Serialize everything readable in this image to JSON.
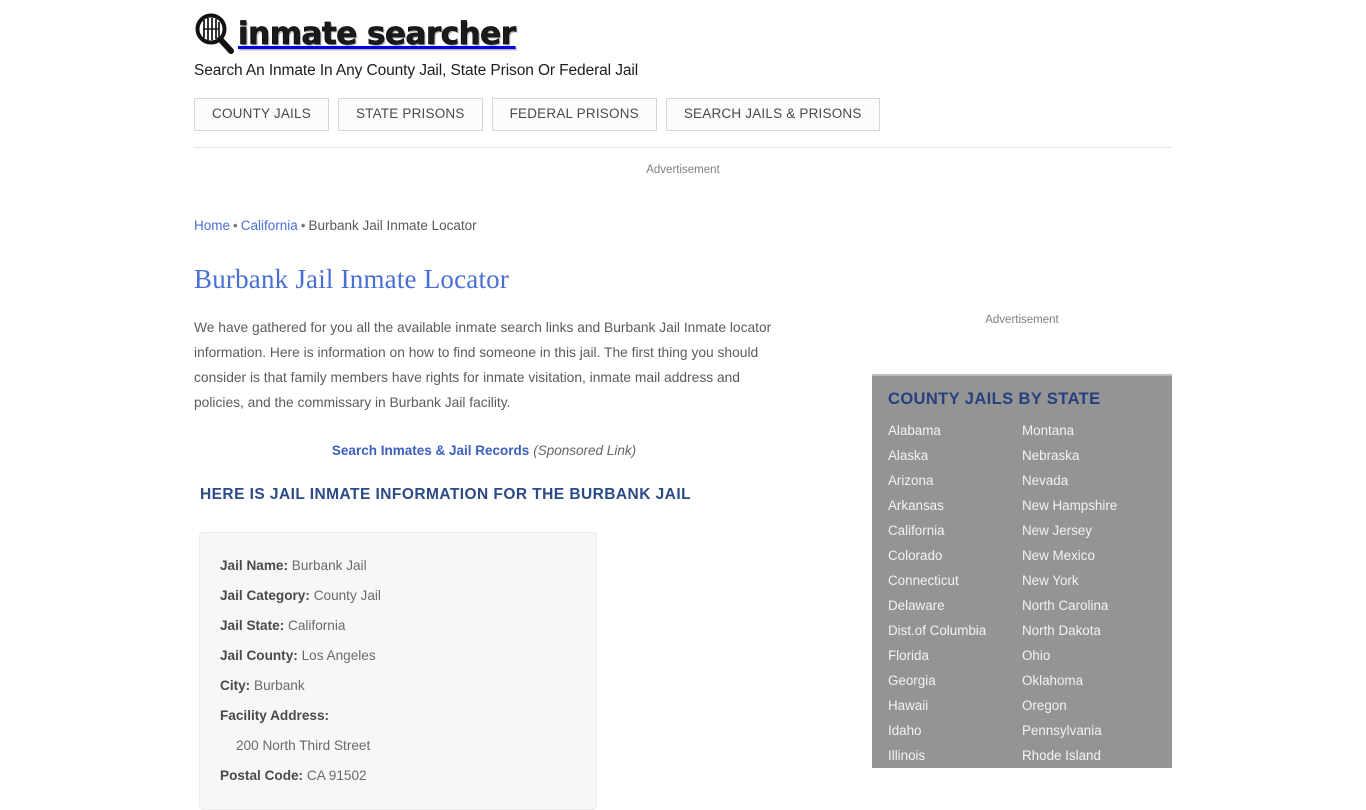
{
  "site": {
    "logo_text": "inmate searcher",
    "logo_icon": "magnifier-prison-bars-icon",
    "tagline": "Search An Inmate In Any County Jail, State Prison Or Federal Jail"
  },
  "nav": {
    "items": [
      {
        "label": "COUNTY JAILS"
      },
      {
        "label": "STATE PRISONS"
      },
      {
        "label": "FEDERAL PRISONS"
      },
      {
        "label": "SEARCH JAILS & PRISONS"
      }
    ]
  },
  "ads": {
    "top_label": "Advertisement",
    "side_label": "Advertisement"
  },
  "breadcrumb": {
    "home": "Home",
    "sep1": "•",
    "state": "California",
    "sep2": "•",
    "current": "Burbank Jail Inmate Locator"
  },
  "main": {
    "title": "Burbank Jail Inmate Locator",
    "intro": "We have gathered for you all the available inmate search links and Burbank Jail Inmate locator information. Here is information on how to find someone in this jail. The first thing you should consider is that family members have rights for inmate visitation, inmate mail address and policies, and the commissary in Burbank Jail facility.",
    "sponsored_link": "Search Inmates & Jail Records",
    "sponsored_note": "(Sponsored Link)",
    "section_title": "HERE IS JAIL INMATE INFORMATION FOR THE BURBANK JAIL"
  },
  "info_card": {
    "rows": [
      {
        "key": "Jail Name:",
        "value": "Burbank Jail"
      },
      {
        "key": "Jail Category:",
        "value": "County Jail"
      },
      {
        "key": "Jail State:",
        "value": "California"
      },
      {
        "key": "Jail County:",
        "value": "Los Angeles"
      },
      {
        "key": "City:",
        "value": "Burbank"
      },
      {
        "key": "Facility Address:",
        "value": ""
      },
      {
        "key": "",
        "value": "200 North Third Street"
      },
      {
        "key": "Postal Code:",
        "value": "CA 91502"
      }
    ]
  },
  "sidebar": {
    "widget_title": "COUNTY JAILS BY STATE",
    "bg_color": "#949494",
    "title_color": "#24407e",
    "col_left": [
      "Alabama",
      "Alaska",
      "Arizona",
      "Arkansas",
      "California",
      "Colorado",
      "Connecticut",
      "Delaware",
      "Dist.of Columbia",
      "Florida",
      "Georgia",
      "Hawaii",
      "Idaho",
      "Illinois"
    ],
    "col_right": [
      "Montana",
      "Nebraska",
      "Nevada",
      "New Hampshire",
      "New Jersey",
      "New Mexico",
      "New York",
      "North Carolina",
      "North Dakota",
      "Ohio",
      "Oklahoma",
      "Oregon",
      "Pennsylvania",
      "Rhode Island"
    ]
  },
  "colors": {
    "link_blue": "#4a6fd4",
    "heading_navy": "#2b4a86",
    "sidebar_gray": "#949494"
  }
}
